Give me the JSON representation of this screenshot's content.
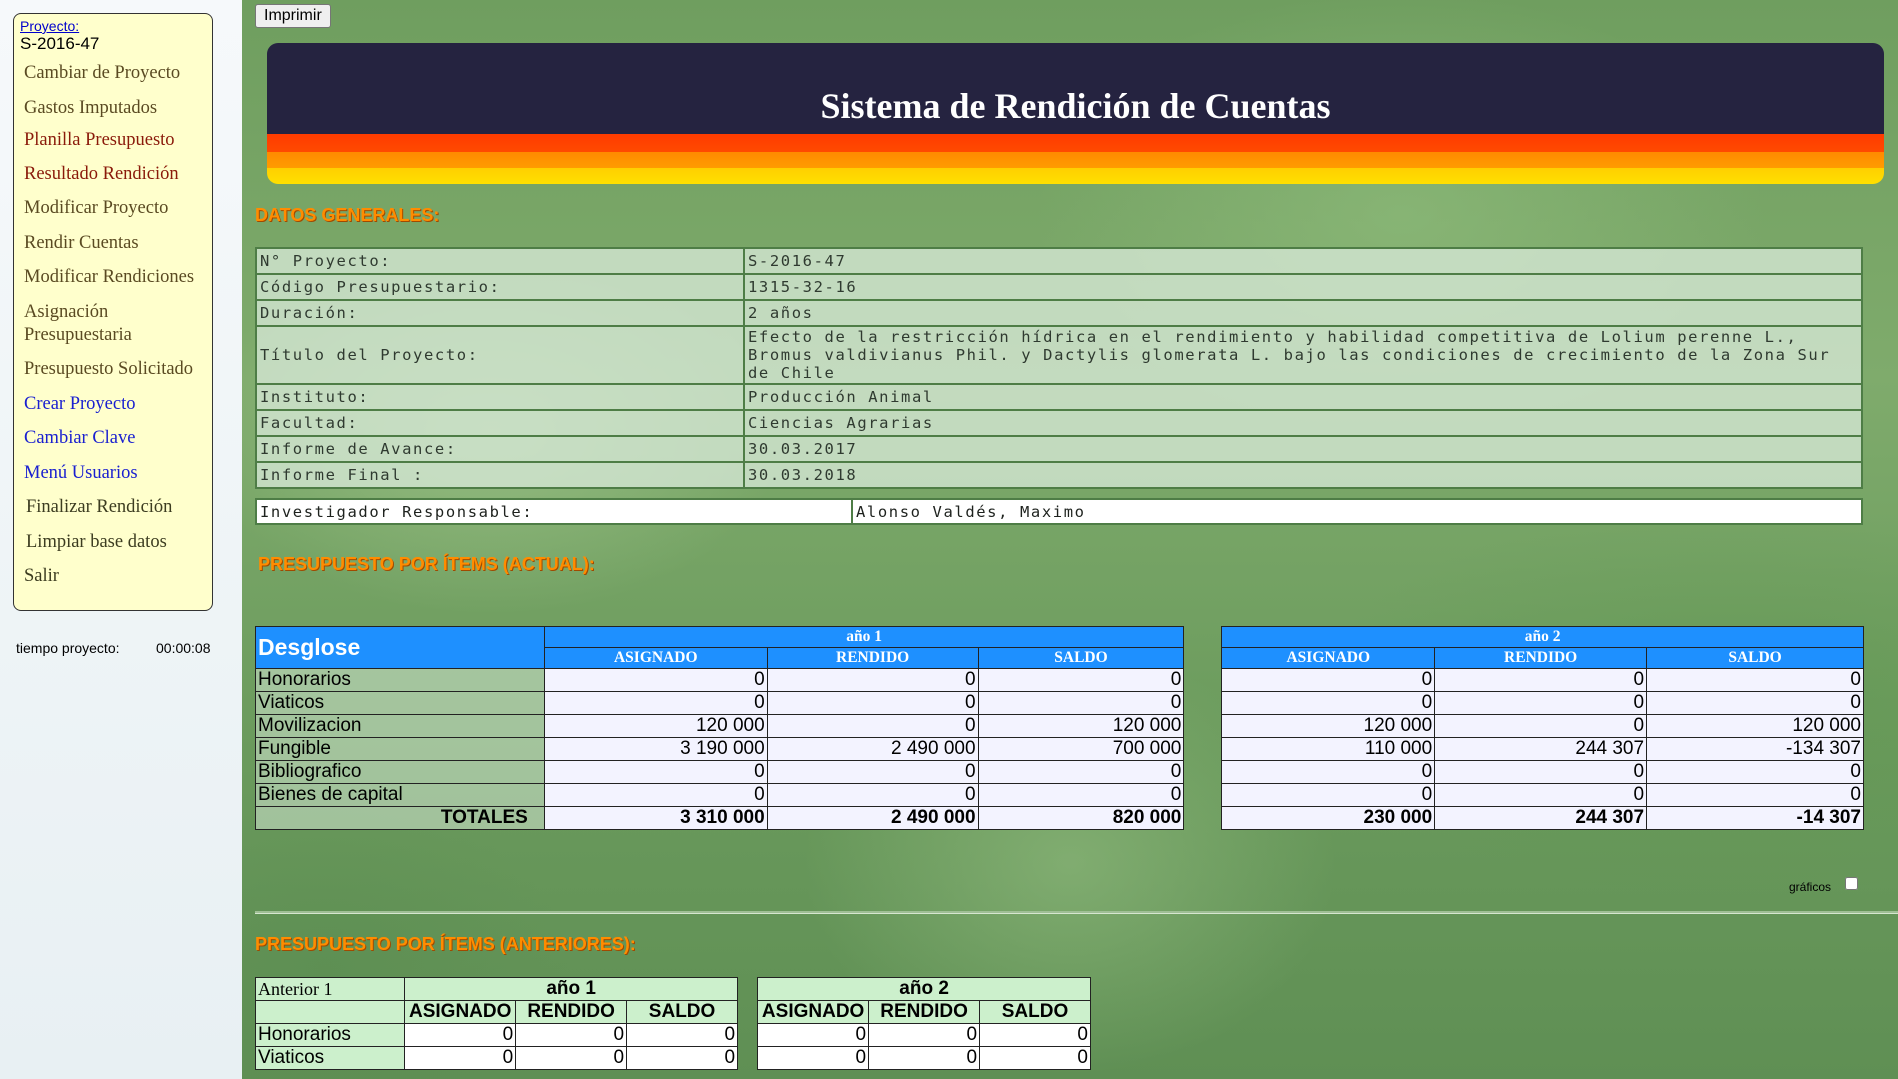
{
  "sidebar": {
    "project_link": "Proyecto:",
    "project_code": "S-2016-47",
    "menu": [
      {
        "label": "Cambiar de Proyecto"
      },
      {
        "label": "Gastos Imputados"
      },
      {
        "label": "Planilla Presupuesto"
      },
      {
        "label": "Resultado Rendición"
      },
      {
        "label": "Modificar Proyecto"
      },
      {
        "label": "Rendir Cuentas"
      },
      {
        "label": "Modificar Rendiciones"
      },
      {
        "label": "Asignación Presupuestaria"
      },
      {
        "label": "Presupuesto Solicitado"
      },
      {
        "label": "Crear Proyecto"
      },
      {
        "label": "Cambiar Clave"
      },
      {
        "label": "Menú Usuarios"
      },
      {
        "label": "Finalizar Rendición"
      },
      {
        "label": "Limpiar base datos"
      },
      {
        "label": "Salir"
      }
    ],
    "timer_label": "tiempo proyecto:",
    "timer_value": "00:00:08"
  },
  "toolbar": {
    "print_label": "Imprimir"
  },
  "banner": {
    "title": "Sistema de Rendición de Cuentas"
  },
  "datos_generales": {
    "title": "DATOS GENERALES:",
    "rows": [
      {
        "key": "N° Proyecto:",
        "value": "S-2016-47"
      },
      {
        "key": "Código Presupuestario:",
        "value": "1315-32-16"
      },
      {
        "key": "Duración:",
        "value": "2 años"
      },
      {
        "key": "Título del Proyecto:",
        "value": "Efecto de la restricción hídrica en el rendimiento y habilidad competitiva de Lolium perenne L., Bromus valdivianus Phil. y Dactylis glomerata L. bajo las condiciones de crecimiento de la Zona Sur de Chile"
      },
      {
        "key": "Instituto:",
        "value": "Producción Animal"
      },
      {
        "key": "Facultad:",
        "value": "Ciencias Agrarias"
      },
      {
        "key": "Informe de Avance:",
        "value": "30.03.2017"
      },
      {
        "key": "Informe Final :",
        "value": "30.03.2018"
      }
    ],
    "investigador_label": "Investigador Responsable:",
    "investigador_value": "Alonso Valdés, Maximo"
  },
  "presupuesto_actual": {
    "title": "PRESUPUESTO POR ÍTEMS (ACTUAL):",
    "desglose_label": "Desglose",
    "year1_label": "año 1",
    "year2_label": "año 2",
    "col_asignado": "ASIGNADO",
    "col_rendido": "RENDIDO",
    "col_saldo": "SALDO",
    "rows": [
      {
        "item": "Honorarios",
        "y1": [
          "0",
          "0",
          "0"
        ],
        "y2": [
          "0",
          "0",
          "0"
        ]
      },
      {
        "item": "Viaticos",
        "y1": [
          "0",
          "0",
          "0"
        ],
        "y2": [
          "0",
          "0",
          "0"
        ]
      },
      {
        "item": "Movilizacion",
        "y1": [
          "120 000",
          "0",
          "120 000"
        ],
        "y2": [
          "120 000",
          "0",
          "120 000"
        ]
      },
      {
        "item": "Fungible",
        "y1": [
          "3 190 000",
          "2 490 000",
          "700 000"
        ],
        "y2": [
          "110 000",
          "244 307",
          "-134 307"
        ]
      },
      {
        "item": "Bibliografico",
        "y1": [
          "0",
          "0",
          "0"
        ],
        "y2": [
          "0",
          "0",
          "0"
        ]
      },
      {
        "item": "Bienes de capital",
        "y1": [
          "0",
          "0",
          "0"
        ],
        "y2": [
          "0",
          "0",
          "0"
        ]
      },
      {
        "item": "TOTALES",
        "y1": [
          "3 310 000",
          "2 490 000",
          "820 000"
        ],
        "y2": [
          "230 000",
          "244 307",
          "-14 307"
        ]
      }
    ],
    "graficos_label": "gráficos"
  },
  "presupuesto_anteriores": {
    "title": "PRESUPUESTO POR ÍTEMS (ANTERIORES):",
    "anterior_label": "Anterior 1",
    "year1_label": "año 1",
    "year2_label": "año 2",
    "col_asignado": "ASIGNADO",
    "col_rendido": "RENDIDO",
    "col_saldo": "SALDO",
    "rows": [
      {
        "item": "Honorarios",
        "y1": [
          "0",
          "0",
          "0"
        ],
        "y2": [
          "0",
          "0",
          "0"
        ]
      },
      {
        "item": "Viaticos",
        "y1": [
          "0",
          "0",
          "0"
        ],
        "y2": [
          "0",
          "0",
          "0"
        ]
      }
    ]
  }
}
